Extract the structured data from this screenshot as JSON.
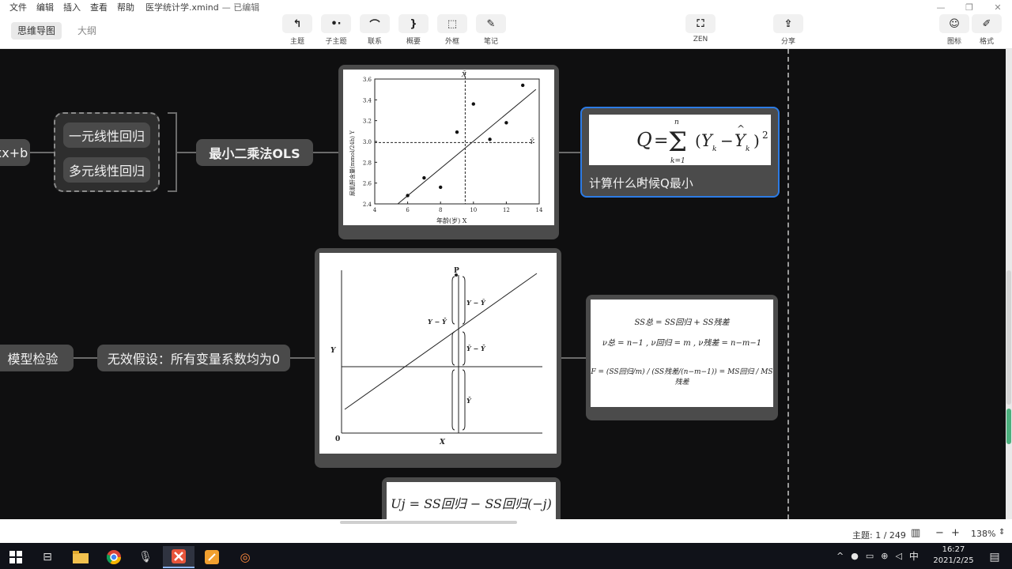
{
  "menu": {
    "items": [
      "文件",
      "编辑",
      "插入",
      "查看",
      "帮助"
    ],
    "doc_title": "医学统计学.xmind",
    "save_status": "— 已编辑"
  },
  "toolbar": {
    "view_tabs": [
      "思维导图",
      "大纲"
    ],
    "buttons": [
      "主题",
      "子主题",
      "联系",
      "概要",
      "外框",
      "笔记"
    ],
    "zen": "ZEN",
    "share": "分享",
    "icons_label": "图标",
    "format_label": "格式"
  },
  "canvas": {
    "node_formula": "xx+b",
    "group_simple": "一元线性回归",
    "group_multi": "多元线性回归",
    "ols": "最小二乘法OLS",
    "model_test": "模型检验",
    "null_hypothesis": "无效假设：所有变量系数均为0",
    "q_caption": "计算什么时候Q最小"
  },
  "figures": {
    "scatter": {
      "y_ticks": [
        "2.4",
        "2.6",
        "2.8",
        "3.0",
        "3.2",
        "3.4",
        "3.6"
      ],
      "x_ticks": [
        "4",
        "6",
        "8",
        "10",
        "12",
        "14"
      ],
      "xlabel": "年龄(岁) X",
      "ylabel": "尿肌酐含量(mmol/24h) Y",
      "top_label": "X̄",
      "right_label": "Ȳ"
    },
    "decomp": {
      "p_label": "P",
      "y_axis": "Y",
      "x_axis": "X",
      "origin": "0",
      "y_minus_yhat": "Y − Ŷ",
      "y_minus_ybar": "Y − Ȳ",
      "yhat_minus_ybar": "Ŷ − Ȳ",
      "ybar": "Ȳ"
    },
    "q_formula": "Q = Σ(Yₖ − Ŷₖ)²",
    "ss_lines": [
      "SS总 = SS回归 + SS残差",
      "ν总 = n−1 , ν回归 = m , ν残差 = n−m−1",
      "F = (SS回归/m) / (SS残差/(n−m−1)) = MS回归 / MS残差"
    ],
    "uj_formula": "Uj = SS回归 − SS回归(−j)"
  },
  "chart_data": {
    "type": "scatter",
    "title": "",
    "xlabel": "年龄(岁) X",
    "ylabel": "尿肌酐含量(mmol/24h) Y",
    "xlim": [
      4,
      14
    ],
    "ylim": [
      2.4,
      3.6
    ],
    "points": [
      {
        "x": 6,
        "y": 2.48
      },
      {
        "x": 7,
        "y": 2.65
      },
      {
        "x": 8,
        "y": 2.56
      },
      {
        "x": 9,
        "y": 3.09
      },
      {
        "x": 10,
        "y": 3.36
      },
      {
        "x": 11,
        "y": 3.02
      },
      {
        "x": 12,
        "y": 3.18
      },
      {
        "x": 13,
        "y": 3.54
      }
    ],
    "regression_line": [
      {
        "x": 5.4,
        "y": 2.4
      },
      {
        "x": 13.8,
        "y": 3.5
      }
    ],
    "x_mean": 9.5,
    "y_mean": 2.99
  },
  "statusbar": {
    "topic_count": "主题: 1 / 249",
    "zoom": "138%"
  },
  "taskbar": {
    "time": "16:27",
    "date": "2021/2/25",
    "ime": "中"
  }
}
